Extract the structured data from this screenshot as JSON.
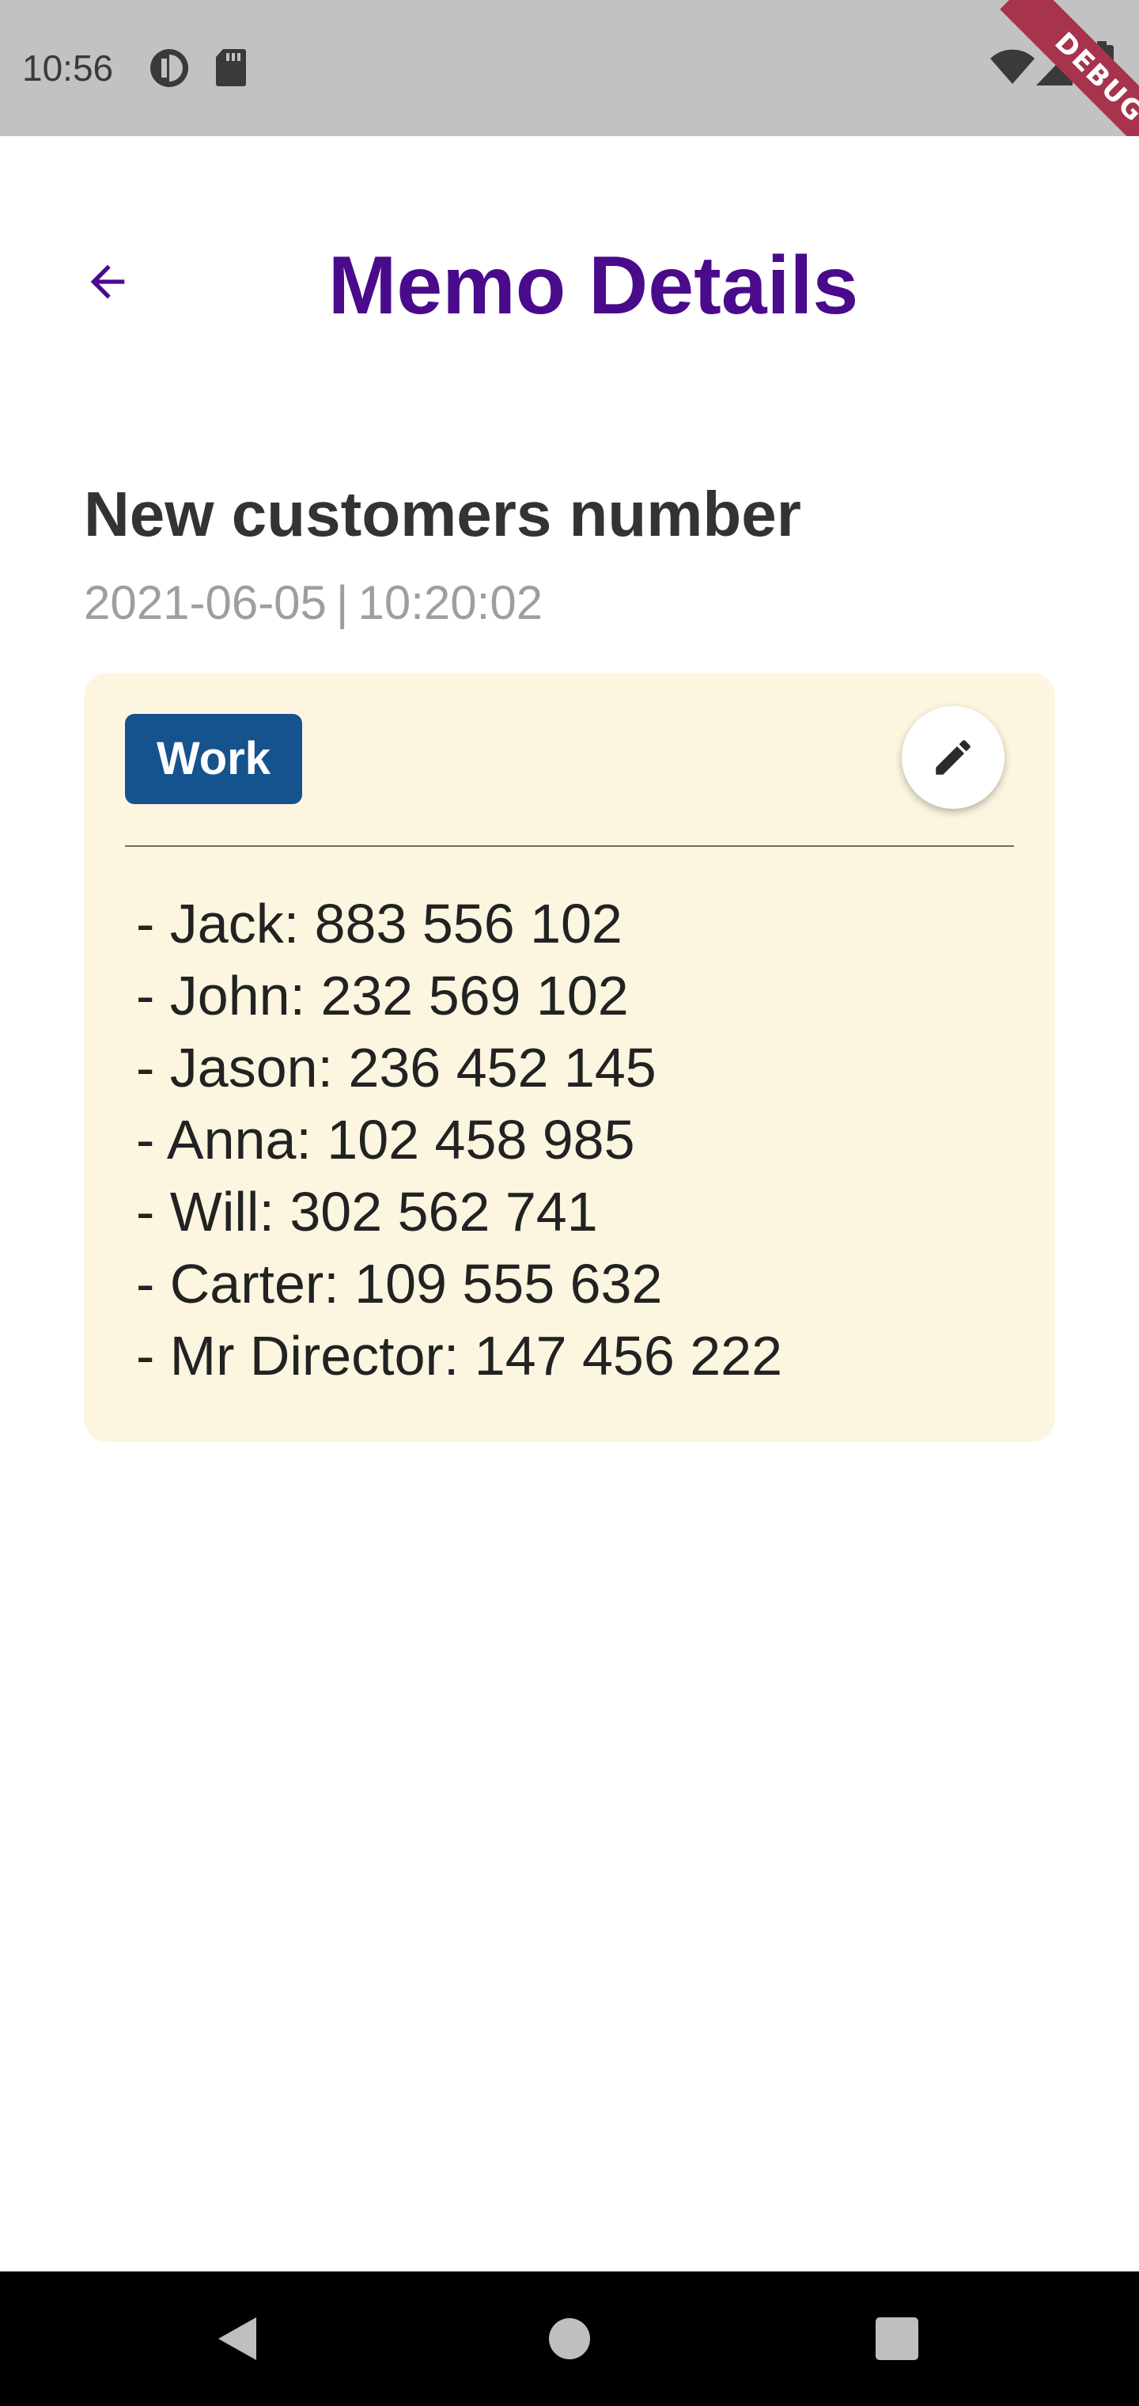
{
  "status_bar": {
    "time": "10:56",
    "left_icons": [
      "data-saver-icon",
      "sd-card-icon"
    ],
    "right_icons": [
      "wifi-icon",
      "signal-icon",
      "battery-icon"
    ],
    "debug_banner": "DEBUG"
  },
  "app_bar": {
    "back_icon": "arrow-back-icon",
    "title": "Memo Details"
  },
  "memo": {
    "title": "New customers number",
    "date": "2021-06-05",
    "separator": "|",
    "time": "10:20:02",
    "category": "Work",
    "edit_icon": "pencil-icon",
    "lines": [
      "- Jack: 883 556 102",
      "- John: 232 569 102",
      "- Jason: 236 452 145",
      "- Anna: 102 458 985",
      "- Will: 302 562 741",
      "- Carter: 109 555 632",
      "- Mr Director: 147 456 222"
    ]
  },
  "nav_bar": {
    "back_icon": "nav-back-icon",
    "home_icon": "nav-home-icon",
    "recents_icon": "nav-recents-icon"
  },
  "colors": {
    "title_purple": "#4a0a8c",
    "card_background": "#fcf6e1",
    "badge_blue": "#15538f",
    "status_bar": "#c2c2c2",
    "debug_ribbon": "#a8334d"
  }
}
